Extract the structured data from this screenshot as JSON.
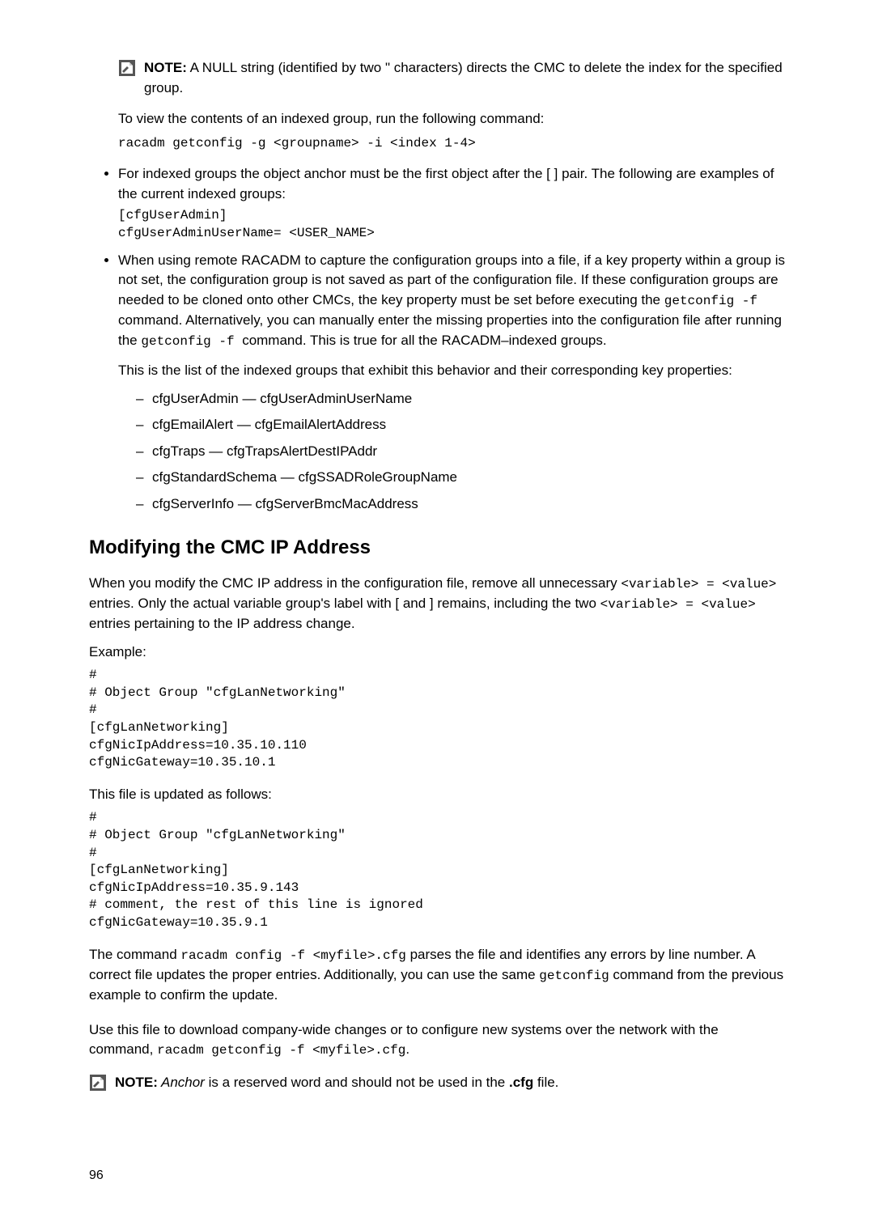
{
  "note1": {
    "label": "NOTE:",
    "text": " A NULL string (identified by two \" characters) directs the CMC to delete the index for the specified group."
  },
  "para_viewcontents": "To view the contents of an indexed group, run the following command:",
  "code_viewcontents": "racadm getconfig -g <groupname> -i <index 1-4>",
  "bullet_indexed": {
    "text": "For indexed groups the object anchor must be the first object after the [ ] pair. The following are examples of the current indexed groups:",
    "code": "[cfgUserAdmin]\ncfgUserAdminUserName= <USER_NAME>"
  },
  "bullet_remote": {
    "part1": "When using remote RACADM to capture the configuration groups into a file, if a key property within a group is not set, the configuration group is not saved as part of the configuration file. If these configuration groups are needed to be cloned onto other CMCs, the key property must be set before executing the ",
    "mono1": "getconfig -f",
    "part2": " command. Alternatively, you can manually enter the missing properties into the configuration file after running the ",
    "mono2": "getconfig -f ",
    "part3": " command. This is true for all the RACADM–indexed groups.",
    "sub_para": "This is the list of the indexed groups that exhibit this behavior and their corresponding key properties:",
    "items": [
      "cfgUserAdmin — cfgUserAdminUserName",
      "cfgEmailAlert — cfgEmailAlertAddress",
      "cfgTraps — cfgTrapsAlertDestIPAddr",
      "cfgStandardSchema — cfgSSADRoleGroupName",
      "cfgServerInfo — cfgServerBmcMacAddress"
    ]
  },
  "heading_modify": "Modifying the CMC IP Address",
  "para_modify": {
    "part1": "When you modify the CMC IP address in the configuration file, remove all unnecessary ",
    "mono1": "<variable> = <value>",
    "part2": " entries. Only the actual variable group's label with [ and ] remains, including the two ",
    "mono2": "<variable> = <value>",
    "part3": " entries pertaining to the IP address change."
  },
  "label_example": "Example:",
  "code_example1": "#\n# Object Group \"cfgLanNetworking\"\n#\n[cfgLanNetworking]\ncfgNicIpAddress=10.35.10.110\ncfgNicGateway=10.35.10.1",
  "label_updated": "This file is updated as follows:",
  "code_example2": "#\n# Object Group \"cfgLanNetworking\"\n#\n[cfgLanNetworking]\ncfgNicIpAddress=10.35.9.143\n# comment, the rest of this line is ignored\ncfgNicGateway=10.35.9.1",
  "para_command": {
    "part1": "The command ",
    "mono1": "racadm config -f <myfile>.cfg",
    "part2": " parses the file and identifies any errors by line number. A correct file updates the proper entries. Additionally, you can use the same ",
    "mono2": "getconfig",
    "part3": " command from the previous example to confirm the update."
  },
  "para_download": {
    "part1": "Use this file to download company-wide changes or to configure new systems over the network with the command, ",
    "mono1": "racadm getconfig -f <myfile>.cfg",
    "part2": "."
  },
  "note2": {
    "label": "NOTE:",
    "italic": " Anchor",
    "rest": " is a reserved word and should not be used in the ",
    "bold": ".cfg",
    "tail": " file."
  },
  "page_number": "96"
}
